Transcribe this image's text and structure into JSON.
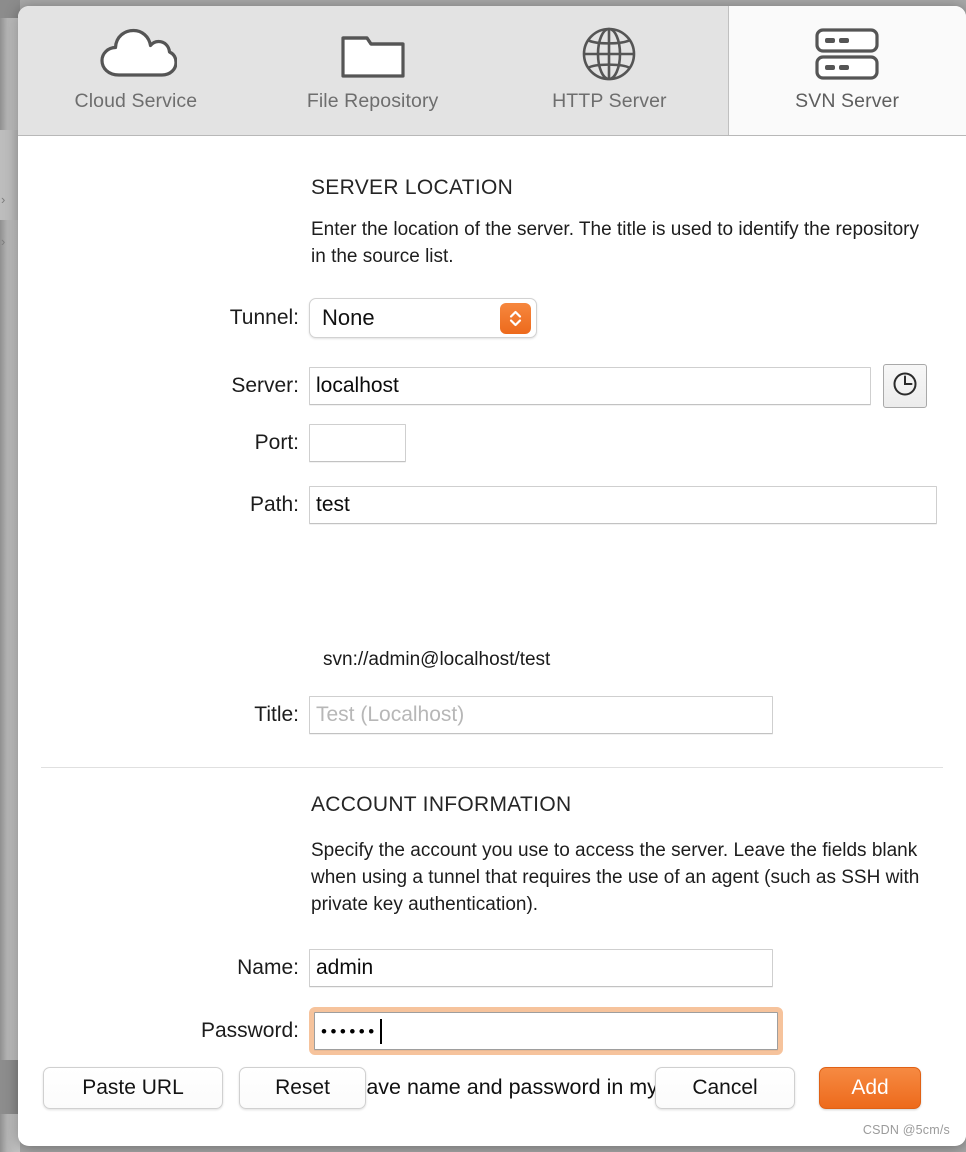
{
  "toolbar": {
    "tabs": [
      {
        "label": "Cloud Service",
        "icon": "cloud-icon",
        "selected": false
      },
      {
        "label": "File Repository",
        "icon": "folder-icon",
        "selected": false
      },
      {
        "label": "HTTP Server",
        "icon": "globe-icon",
        "selected": false
      },
      {
        "label": "SVN Server",
        "icon": "server-rack-icon",
        "selected": true
      }
    ]
  },
  "server_location": {
    "heading": "SERVER LOCATION",
    "description": "Enter the location of the server. The title is used to identify the repository in the source list.",
    "tunnel": {
      "label": "Tunnel:",
      "value": "None"
    },
    "server": {
      "label": "Server:",
      "value": "localhost",
      "history_icon": "clock-icon"
    },
    "port": {
      "label": "Port:",
      "value": ""
    },
    "path": {
      "label": "Path:",
      "value": "test"
    },
    "url_preview": "svn://admin@localhost/test",
    "title": {
      "label": "Title:",
      "value": "",
      "placeholder": "Test (Localhost)"
    }
  },
  "account_information": {
    "heading": "ACCOUNT INFORMATION",
    "description": "Specify the account you use to access the server. Leave the fields blank when using a tunnel that requires the use of an agent (such as SSH with private key authentication).",
    "name": {
      "label": "Name:",
      "value": "admin"
    },
    "password": {
      "label": "Password:",
      "value": "••••••",
      "focused": true
    },
    "keychain": {
      "label": "Save name and password in my keychain",
      "checked": true
    }
  },
  "buttons": {
    "paste_url": "Paste URL",
    "reset": "Reset",
    "cancel": "Cancel",
    "add": "Add"
  },
  "watermark": "CSDN @5cm/s",
  "colors": {
    "accent": "#ed6a1c",
    "accent_light": "#f68a42",
    "focus_ring": "#f6c39c",
    "toolbar_bg": "#e3e3e3",
    "tab_selected_bg": "#fafafa",
    "label_text": "#1c1c1c",
    "tab_text": "#6e6e6e"
  }
}
